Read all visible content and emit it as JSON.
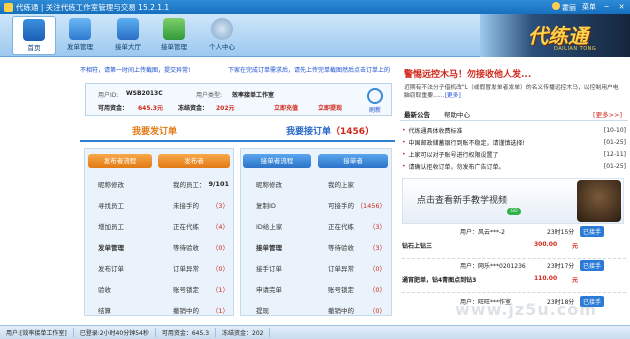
{
  "window": {
    "title": "代练通 | 关注代练工作室管理与交易 15.2.1.1",
    "user_menu": "霍丽",
    "menu": "菜单",
    "minimize": "─",
    "close": "✕"
  },
  "toolbar": {
    "items": [
      {
        "label": "首页",
        "icon": "home-icon"
      },
      {
        "label": "发单管理",
        "icon": "publish-icon"
      },
      {
        "label": "接单大厅",
        "icon": "hall-icon"
      },
      {
        "label": "接单管理",
        "icon": "receive-icon"
      },
      {
        "label": "个人中心",
        "icon": "person-icon"
      }
    ],
    "brand_logo": "代练通",
    "brand_sub": "DAILIAN TONG"
  },
  "links": [
    "不相符，请第一时间上传截图，提交异常!",
    "下家在完成订单需求后，请先上传完单截图然后点击订单上的"
  ],
  "account": {
    "id_label": "用户ID:",
    "id_value": "WSB2013C",
    "type_label": "用户类型:",
    "type_value": "效率接单工作室",
    "avail_label": "可用资金：",
    "avail_value": "645.3元",
    "frozen_label": "冻结资金：",
    "frozen_value": "202元",
    "recharge": "立即充值",
    "withdraw": "立即提现",
    "refresh": "刷新"
  },
  "tabs": {
    "publish": "我要发订单",
    "receive": "我要接订单",
    "receive_count": "（1456）"
  },
  "publish_flow": {
    "title": "发布者流程",
    "steps": [
      "昵称修改",
      "寻找员工",
      "增加员工",
      "发单管理",
      "发布订单",
      "验收",
      "结算"
    ]
  },
  "publisher": {
    "title": "发布者",
    "items": [
      {
        "label": "我的员工：",
        "count": "9/101"
      },
      {
        "label": "未接手的",
        "count": "（3）"
      },
      {
        "label": "正在代练",
        "count": "（4）"
      },
      {
        "label": "等待验收",
        "count": "（0）"
      },
      {
        "label": "订单异常",
        "count": "（0）"
      },
      {
        "label": "账号锁定",
        "count": "（1）"
      },
      {
        "label": "撤销中的",
        "count": "（1）"
      }
    ]
  },
  "receive_flow": {
    "title": "接单者流程",
    "steps": [
      "昵称修改",
      "复制ID",
      "ID给上家",
      "接单管理",
      "接手订单",
      "申请完单",
      "提现"
    ]
  },
  "receiver": {
    "title": "接单者",
    "items": [
      {
        "label": "我的上家",
        "count": ""
      },
      {
        "label": "可接手的",
        "count": "（1456）"
      },
      {
        "label": "正在代练",
        "count": "（3）"
      },
      {
        "label": "等待验收",
        "count": "（3）"
      },
      {
        "label": "订单异常",
        "count": "（0）"
      },
      {
        "label": "账号锁定",
        "count": "（0）"
      },
      {
        "label": "撤销中的",
        "count": "（0）"
      }
    ]
  },
  "right": {
    "warning": "警惕远控木马！勿接收他人发...",
    "warning_sub": "近期有不法分子借机改\"L（或假冒发单者发单）的名义传播远控木马，以控制用户电脑窃取重要……",
    "warning_more": "[更多]",
    "tab_latest": "最新公告",
    "tab_help": "帮助中心",
    "tab_more": "[更多>>]",
    "notices": [
      {
        "text": "代练通具体收费标准",
        "date": "[10-10]"
      },
      {
        "text": "中国邮政储蓄银行到账不稳定，请谨慎选择!",
        "date": "[01-25]"
      },
      {
        "text": "上家可以对子账号进行权限设置了",
        "date": "[12-11]"
      },
      {
        "text": "请确认拒收订单，勿发布广告订单。",
        "date": "[01-25]"
      }
    ],
    "banner_text": "点击查看新手教学视频",
    "banner_go": "GO",
    "orders": [
      {
        "user": "用户：风云***-2",
        "time": "23时15分",
        "tag": "已接手",
        "title": "钻石上钻三",
        "price": "300.00",
        "unit": "元"
      },
      {
        "user": "用户：网乐***0201236",
        "time": "23时17分",
        "tag": "已接手",
        "title": "通宵肥单，钻4青图点到钻3",
        "price": "110.00",
        "unit": "元"
      },
      {
        "user": "用户：旺旺***作室",
        "time": "23时18分",
        "tag": "已接手",
        "title": "",
        "price": "",
        "unit": ""
      }
    ]
  },
  "status": {
    "user": "用户:[效率接单工作室]",
    "logged": "已登录:2小时40分钟54秒",
    "avail": "可用资金：645.3",
    "frozen": "冻结资金：202"
  },
  "watermark": "www.jz5u.com",
  "colors": {
    "accent": "#2f7fd0",
    "alert": "#d0271b",
    "orange": "#e27a14"
  }
}
